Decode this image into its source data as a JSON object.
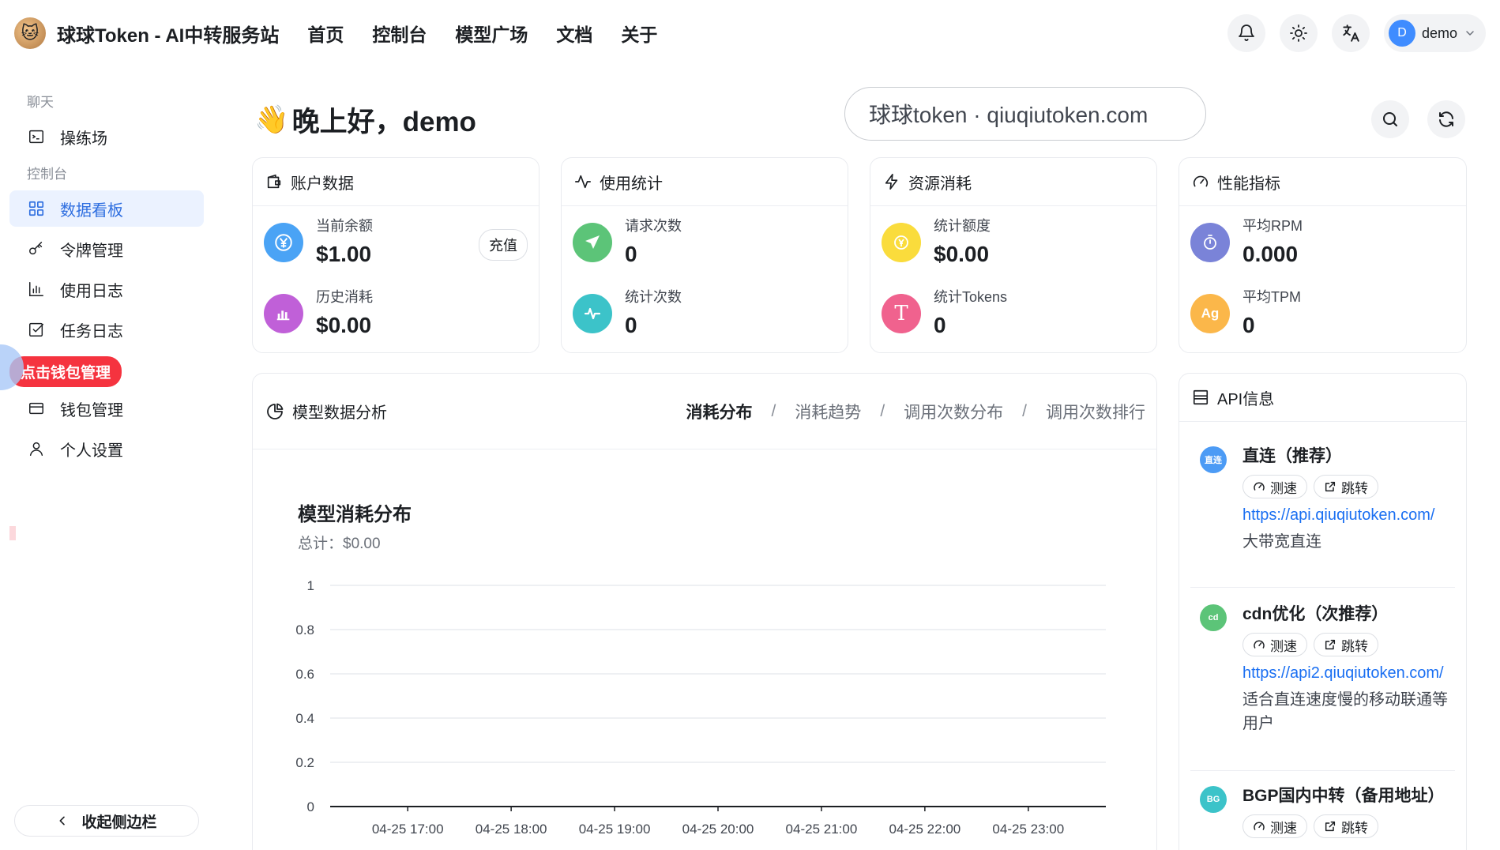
{
  "header": {
    "title": "球球Token - AI中转服务站",
    "nav": [
      "首页",
      "控制台",
      "模型广场",
      "文档",
      "关于"
    ],
    "user": {
      "avatar_letter": "D",
      "name": "demo"
    }
  },
  "sidebar": {
    "group_chat": "聊天",
    "playground": "操练场",
    "group_console": "控制台",
    "items": [
      "数据看板",
      "令牌管理",
      "使用日志",
      "任务日志"
    ],
    "wallet_badge": "点击钱包管理",
    "wallet": "钱包管理",
    "settings": "个人设置",
    "collapse": "收起侧边栏"
  },
  "greeting": {
    "emoji": "👋",
    "text": "晚上好，demo"
  },
  "domain_box": "球球token · qiuqiutoken.com",
  "cards": {
    "account": {
      "title": "账户数据",
      "balance_label": "当前余额",
      "balance": "$1.00",
      "recharge": "充值",
      "spent_label": "历史消耗",
      "spent": "$0.00"
    },
    "usage": {
      "title": "使用统计",
      "req_label": "请求次数",
      "req": "0",
      "cnt_label": "统计次数",
      "cnt": "0"
    },
    "resource": {
      "title": "资源消耗",
      "quota_label": "统计额度",
      "quota": "$0.00",
      "tokens_label": "统计Tokens",
      "tokens": "0"
    },
    "perf": {
      "title": "性能指标",
      "rpm_label": "平均RPM",
      "rpm": "0.000",
      "tpm_label": "平均TPM",
      "tpm": "0",
      "tpm_icon_text": "Ag"
    }
  },
  "analysis": {
    "title": "模型数据分析",
    "tabs": [
      "消耗分布",
      "消耗趋势",
      "调用次数分布",
      "调用次数排行"
    ],
    "active_tab": "消耗分布",
    "tab_separator": "/",
    "chart_title": "模型消耗分布",
    "chart_total": "总计：$0.00"
  },
  "chart_data": {
    "type": "bar",
    "title": "模型消耗分布",
    "categories": [
      "04-25 17:00",
      "04-25 18:00",
      "04-25 19:00",
      "04-25 20:00",
      "04-25 21:00",
      "04-25 22:00",
      "04-25 23:00"
    ],
    "series": [],
    "yticks": [
      "0",
      "0.2",
      "0.4",
      "0.6",
      "0.8",
      "1"
    ],
    "ylim": [
      0,
      1
    ],
    "grid": true
  },
  "api": {
    "title": "API信息",
    "items": [
      {
        "badge": "直连",
        "badge_color": "#4c9bf5",
        "name": "直连（推荐）",
        "speed": "测速",
        "jump": "跳转",
        "url": "https://api.qiuqiutoken.com/",
        "desc": "大带宽直连"
      },
      {
        "badge": "cd",
        "badge_color": "#5cc478",
        "name": "cdn优化（次推荐）",
        "speed": "测速",
        "jump": "跳转",
        "url": "https://api2.qiuqiutoken.com/",
        "desc": "适合直连速度慢的移动联通等用户"
      },
      {
        "badge": "BG",
        "badge_color": "#3cc3c9",
        "name": "BGP国内中转（备用地址）",
        "speed": "测速",
        "jump": "跳转",
        "url": "",
        "desc": ""
      }
    ]
  }
}
